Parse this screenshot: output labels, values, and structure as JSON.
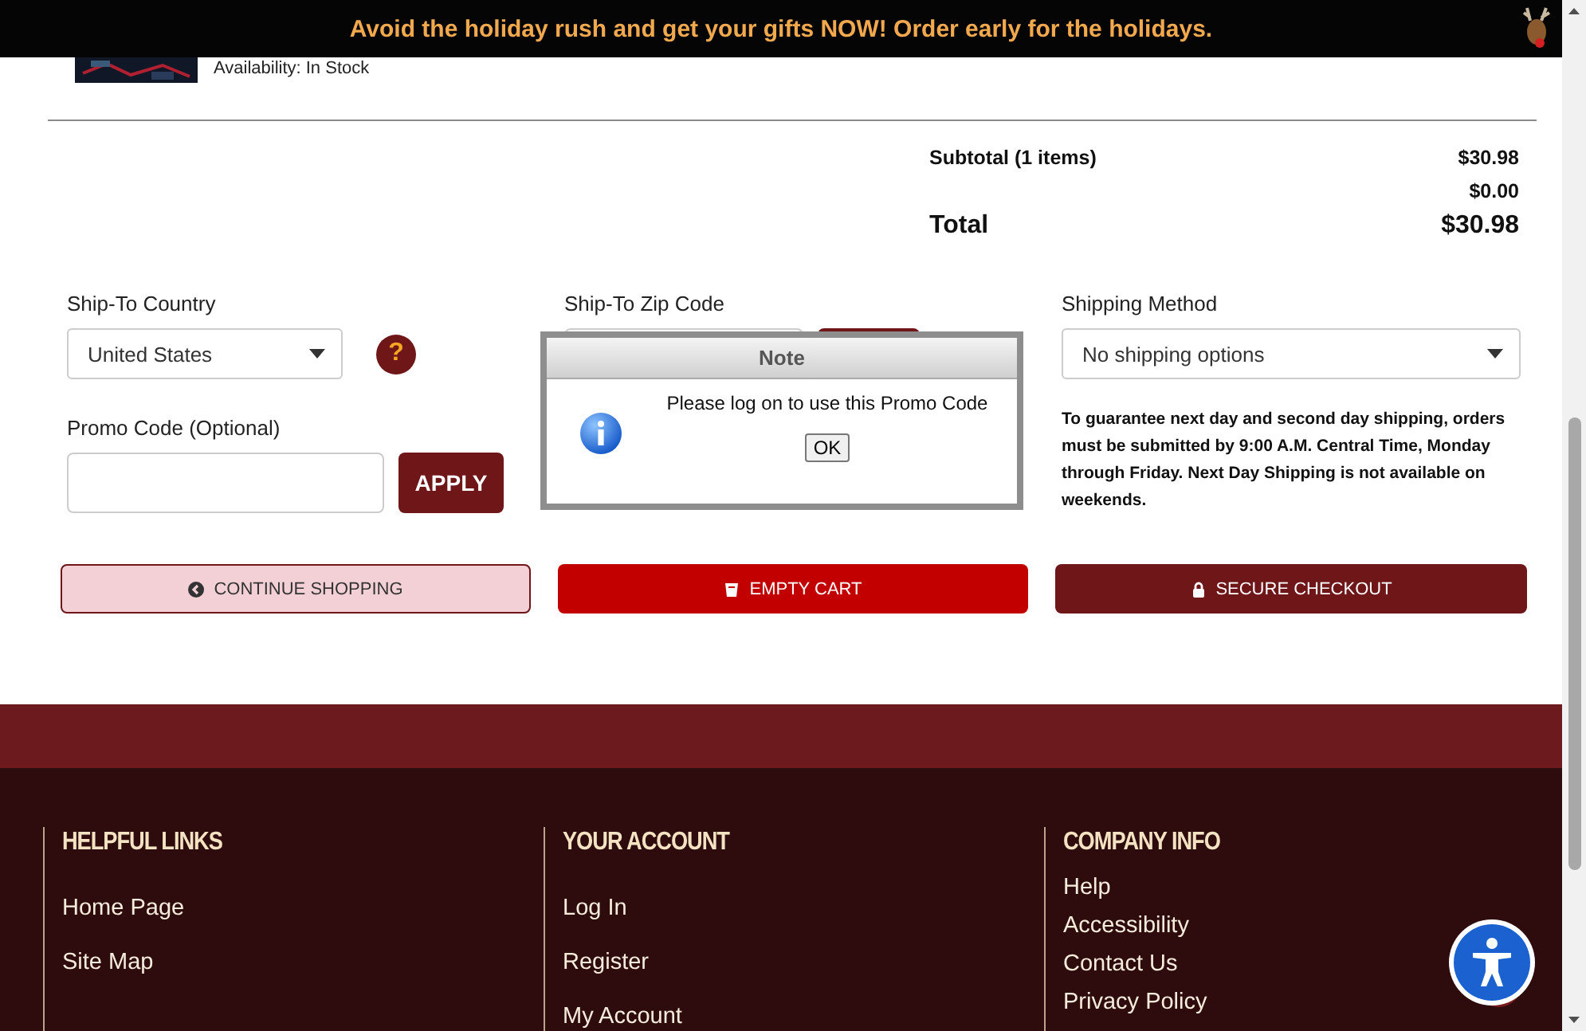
{
  "banner": {
    "text": "Avoid the holiday rush and get your gifts NOW! Order early for the holidays."
  },
  "product": {
    "availability": "Availability: In Stock"
  },
  "totals": [
    {
      "kind": "subtotal",
      "label": "Subtotal (1 items)",
      "value": "$30.98"
    },
    {
      "kind": "line",
      "value": "$0.00"
    },
    {
      "kind": "total",
      "label": "Total",
      "value": "$30.98"
    }
  ],
  "ship_country": {
    "label": "Ship-To Country",
    "value": "United States",
    "help": "?"
  },
  "promo": {
    "label": "Promo Code (Optional)",
    "button": "APPLY"
  },
  "ship_zip": {
    "label": "Ship-To Zip Code"
  },
  "shipping_method": {
    "label": "Shipping Method",
    "value": "No shipping options",
    "note": "To guarantee next day and second day shipping, orders must be submitted by 9:00 A.M. Central Time, Monday through Friday. Next Day Shipping is not available on weekends."
  },
  "actions": [
    {
      "kind": "continue",
      "label": "CONTINUE SHOPPING"
    },
    {
      "kind": "empty",
      "label": "EMPTY CART"
    },
    {
      "kind": "checkout",
      "label": "SECURE CHECKOUT"
    }
  ],
  "dialog": {
    "title": "Note",
    "message": "Please log on to use this Promo Code",
    "button": "OK"
  },
  "footer": [
    {
      "heading": "HELPFUL LINKS",
      "links": [
        "Home Page",
        "Site Map"
      ]
    },
    {
      "heading": "YOUR ACCOUNT",
      "links": [
        "Log In",
        "Register",
        "My Account"
      ]
    },
    {
      "heading": "COMPANY INFO",
      "links": [
        "Help",
        "Accessibility",
        "Contact Us",
        "Privacy Policy"
      ],
      "dense": true
    }
  ]
}
